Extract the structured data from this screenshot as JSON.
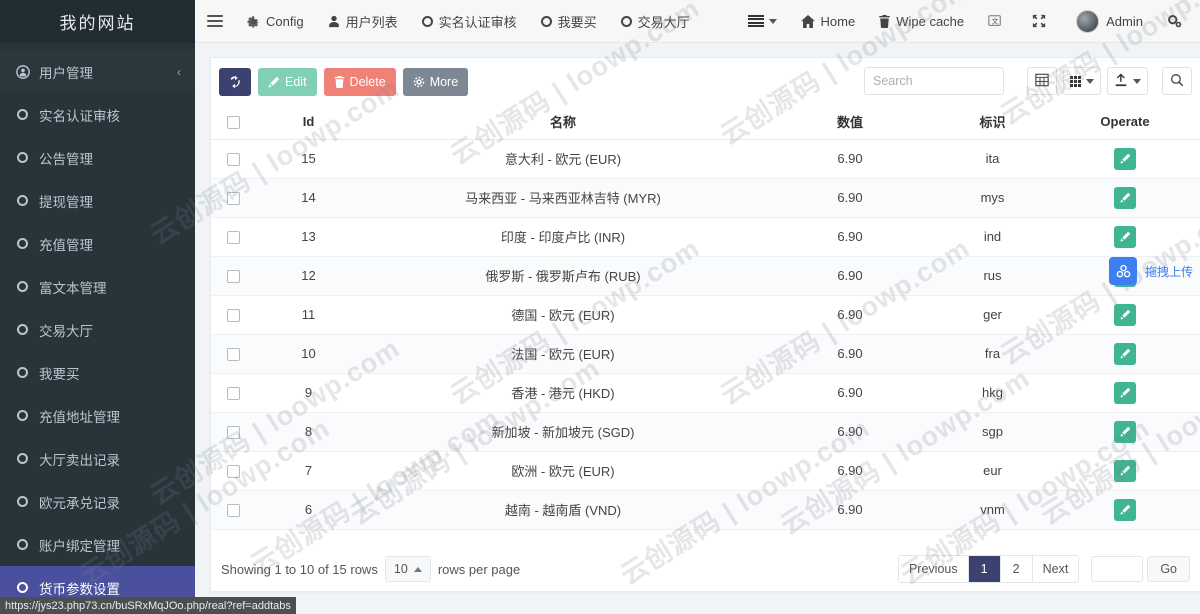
{
  "sidebar": {
    "brand": "我的网站",
    "items": [
      {
        "label": "用户管理",
        "icon": "user-icon",
        "active": false,
        "caret": "‹"
      },
      {
        "label": "实名认证审核",
        "icon": "circle-icon",
        "active": false
      },
      {
        "label": "公告管理",
        "icon": "circle-icon",
        "active": false
      },
      {
        "label": "提现管理",
        "icon": "circle-icon",
        "active": false
      },
      {
        "label": "充值管理",
        "icon": "circle-icon",
        "active": false
      },
      {
        "label": "富文本管理",
        "icon": "circle-icon",
        "active": false
      },
      {
        "label": "交易大厅",
        "icon": "circle-icon",
        "active": false
      },
      {
        "label": "我要买",
        "icon": "circle-icon",
        "active": false
      },
      {
        "label": "充值地址管理",
        "icon": "circle-icon",
        "active": false
      },
      {
        "label": "大厅卖出记录",
        "icon": "circle-icon",
        "active": false
      },
      {
        "label": "欧元承兑记录",
        "icon": "circle-icon",
        "active": false
      },
      {
        "label": "账户绑定管理",
        "icon": "circle-icon",
        "active": false
      },
      {
        "label": "货币参数设置",
        "icon": "circle-icon",
        "active": true
      }
    ]
  },
  "navbar": {
    "menu_toggle": "hamburger-icon",
    "tabs": [
      {
        "label": "Config",
        "icon": "gear-icon"
      },
      {
        "label": "用户列表",
        "icon": "user-icon"
      },
      {
        "label": "实名认证审核",
        "icon": "circle-icon"
      },
      {
        "label": "我要买",
        "icon": "circle-icon"
      },
      {
        "label": "交易大厅",
        "icon": "circle-icon"
      }
    ],
    "right": {
      "tabs_dropdown": "stack-icon",
      "home": "Home",
      "wipe_cache": "Wipe cache",
      "lang": "flag-icon",
      "fullscreen": "fullscreen-icon",
      "user": "Admin",
      "settings": "gears-icon"
    }
  },
  "toolbar": {
    "refresh": "refresh-icon",
    "edit_label": "Edit",
    "delete_label": "Delete",
    "more_label": "More",
    "search_placeholder": "Search",
    "search_value": "",
    "columns_icon": "table-columns-icon",
    "grid_icon": "grid-icon",
    "export_icon": "export-icon",
    "search_icon": "search-icon"
  },
  "table": {
    "columns": [
      "",
      "Id",
      "名称",
      "数值",
      "标识",
      "Operate"
    ],
    "rows": [
      {
        "id": "15",
        "name": "意大利 - 欧元 (EUR)",
        "value": "6.90",
        "tag": "ita"
      },
      {
        "id": "14",
        "name": "马来西亚 - 马来西亚林吉特 (MYR)",
        "value": "6.90",
        "tag": "mys"
      },
      {
        "id": "13",
        "name": "印度 - 印度卢比 (INR)",
        "value": "6.90",
        "tag": "ind"
      },
      {
        "id": "12",
        "name": "俄罗斯 - 俄罗斯卢布 (RUB)",
        "value": "6.90",
        "tag": "rus"
      },
      {
        "id": "11",
        "name": "德国 - 欧元 (EUR)",
        "value": "6.90",
        "tag": "ger"
      },
      {
        "id": "10",
        "name": "法国 - 欧元 (EUR)",
        "value": "6.90",
        "tag": "fra"
      },
      {
        "id": "9",
        "name": "香港 - 港元 (HKD)",
        "value": "6.90",
        "tag": "hkg"
      },
      {
        "id": "8",
        "name": "新加坡 - 新加坡元 (SGD)",
        "value": "6.90",
        "tag": "sgp"
      },
      {
        "id": "7",
        "name": "欧洲 - 欧元 (EUR)",
        "value": "6.90",
        "tag": "eur"
      },
      {
        "id": "6",
        "name": "越南 - 越南盾 (VND)",
        "value": "6.90",
        "tag": "vnm"
      }
    ]
  },
  "footer": {
    "showing": "Showing 1 to 10 of 15 rows",
    "rows_per_page_value": "10",
    "rows_per_page_label": "rows per page",
    "previous": "Previous",
    "page1": "1",
    "page2": "2",
    "next": "Next",
    "jump_value": "",
    "go": "Go"
  },
  "float_upload": {
    "label": "拖拽上传",
    "icon": "cloud-upload-icon"
  },
  "statusbar": {
    "url": "https://jys23.php73.cn/buSRxMqJOo.php/real?ref=addtabs"
  },
  "watermark": {
    "text": "云创源码 | loowp.com"
  },
  "colors": {
    "sidebar_bg": "#28333a",
    "sidebar_active": "#4a4f9e",
    "accent_dark": "#3c4270",
    "edit_green": "#82d0b4",
    "delete_red": "#ef8176",
    "more_gray": "#7e8794",
    "op_green": "#3fb592",
    "upload_blue": "#3d7ef0"
  }
}
